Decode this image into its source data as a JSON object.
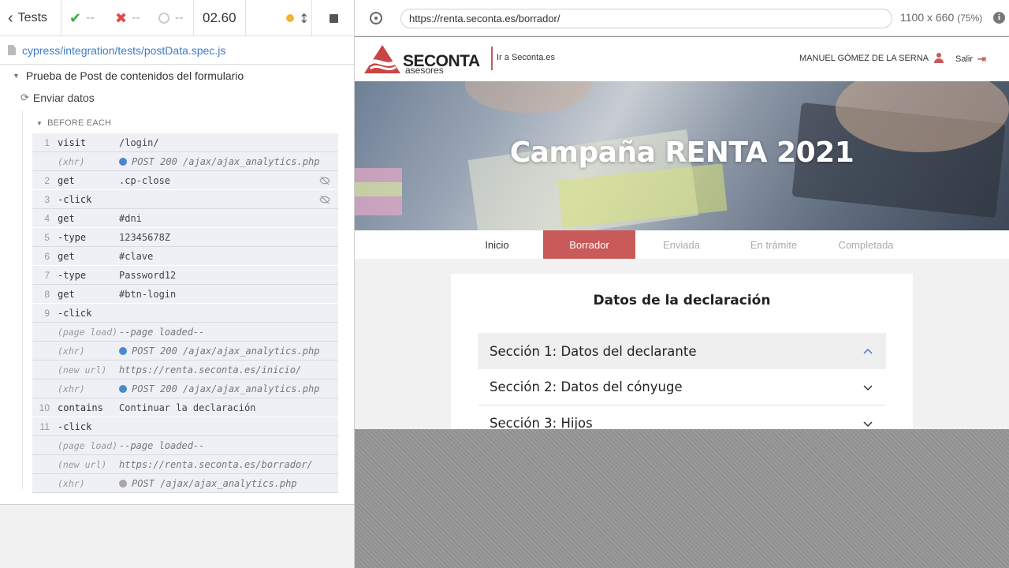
{
  "reporter": {
    "tests_label": "Tests",
    "passed": "--",
    "failed": "--",
    "pending": "--",
    "timer": "02.60",
    "spec_path": "cypress/integration/tests/postData.spec.js",
    "suite_title": "Prueba de Post de contenidos del formulario",
    "test_title": "Enviar datos",
    "hook_title": "BEFORE EACH",
    "commands": [
      {
        "num": "1",
        "name": "visit",
        "msg": "/login/"
      },
      {
        "num": "",
        "name": "(xhr)",
        "msg": "POST 200 /ajax/ajax_analytics.php",
        "event": true,
        "dot": "blue"
      },
      {
        "num": "2",
        "name": "get",
        "msg": ".cp-close",
        "eye": true
      },
      {
        "num": "3",
        "name": "-click",
        "msg": "",
        "eye": true
      },
      {
        "num": "4",
        "name": "get",
        "msg": "#dni"
      },
      {
        "num": "5",
        "name": "-type",
        "msg": "12345678Z"
      },
      {
        "num": "6",
        "name": "get",
        "msg": "#clave"
      },
      {
        "num": "7",
        "name": "-type",
        "msg": "Password12"
      },
      {
        "num": "8",
        "name": "get",
        "msg": "#btn-login"
      },
      {
        "num": "9",
        "name": "-click",
        "msg": ""
      },
      {
        "num": "",
        "name": "(page load)",
        "msg": "--page loaded--",
        "event": true
      },
      {
        "num": "",
        "name": "(xhr)",
        "msg": "POST 200 /ajax/ajax_analytics.php",
        "event": true,
        "dot": "blue"
      },
      {
        "num": "",
        "name": "(new url)",
        "msg": "https://renta.seconta.es/inicio/",
        "event": true
      },
      {
        "num": "",
        "name": "(xhr)",
        "msg": "POST 200 /ajax/ajax_analytics.php",
        "event": true,
        "dot": "blue"
      },
      {
        "num": "10",
        "name": "contains",
        "msg": "Continuar la declaración"
      },
      {
        "num": "11",
        "name": "-click",
        "msg": ""
      },
      {
        "num": "",
        "name": "(page load)",
        "msg": "--page loaded--",
        "event": true
      },
      {
        "num": "",
        "name": "(new url)",
        "msg": "https://renta.seconta.es/borrador/",
        "event": true
      },
      {
        "num": "",
        "name": "(xhr)",
        "msg": "POST /ajax/ajax_analytics.php",
        "event": true,
        "dot": "gray"
      }
    ]
  },
  "aut": {
    "url": "https://renta.seconta.es/borrador/",
    "viewport": "1100 x 660",
    "scale": "(75%)",
    "info_glyph": "i"
  },
  "site": {
    "brand": "SECONTA",
    "brand_sub": "asesores",
    "go_link": "Ir a Seconta.es",
    "user_name": "MANUEL GÓMEZ DE LA SERNA",
    "logout": "Salir",
    "hero_title": "Campaña RENTA 2021",
    "tabs": [
      {
        "label": "Inicio",
        "state": "done"
      },
      {
        "label": "Borrador",
        "state": "active"
      },
      {
        "label": "Enviada",
        "state": "todo"
      },
      {
        "label": "En trámite",
        "state": "todo"
      },
      {
        "label": "Completada",
        "state": "todo"
      }
    ],
    "card_title": "Datos de la declaración",
    "sections": [
      {
        "label": "Sección 1: Datos del declarante",
        "open": true
      },
      {
        "label": "Sección 2: Datos del cónyuge",
        "open": false
      },
      {
        "label": "Sección 3: Hijos",
        "open": false
      }
    ],
    "colors": {
      "brand_red": "#c85a5a",
      "link_blue": "#3b7ccd",
      "pass_green": "#3fab3f",
      "fail_red": "#e04747"
    }
  }
}
